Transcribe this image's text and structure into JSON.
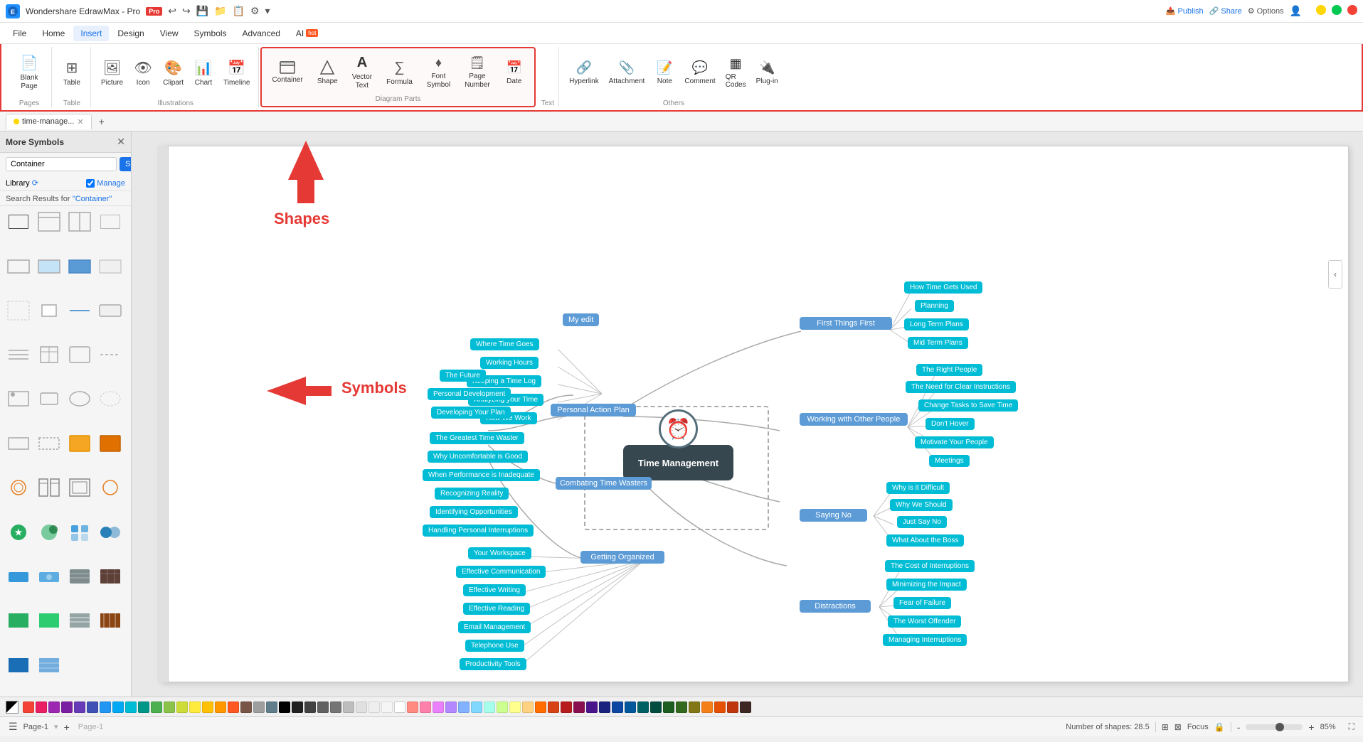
{
  "app": {
    "title": "Wondershare EdrawMax - Pro",
    "logo": "E",
    "filename": "time-manage..."
  },
  "titlebar": {
    "controls": [
      "minimize",
      "maximize",
      "close"
    ]
  },
  "menubar": {
    "items": [
      "File",
      "Home",
      "Insert",
      "Design",
      "View",
      "Symbols",
      "Advanced",
      "AI",
      "Publish",
      "Share",
      "Options"
    ]
  },
  "ribbon": {
    "active_tab": "Insert",
    "groups": [
      {
        "label": "Pages",
        "items": [
          {
            "icon": "📄",
            "label": "Blank\nPage"
          }
        ]
      },
      {
        "label": "Table",
        "items": [
          {
            "icon": "⊞",
            "label": "Table"
          }
        ]
      },
      {
        "label": "Illustrations",
        "items": [
          {
            "icon": "🖼",
            "label": "Picture"
          },
          {
            "icon": "👁",
            "label": "Icon"
          },
          {
            "icon": "🎨",
            "label": "Clipart"
          },
          {
            "icon": "📊",
            "label": "Chart"
          },
          {
            "icon": "📅",
            "label": "Timeline"
          }
        ]
      },
      {
        "label": "Diagram Parts",
        "items": [
          {
            "icon": "▭",
            "label": "Container"
          },
          {
            "icon": "◇",
            "label": "Shape"
          },
          {
            "icon": "A",
            "label": "Vector\nText"
          },
          {
            "icon": "∑",
            "label": "Formula"
          },
          {
            "icon": "♦",
            "label": "Font\nSymbol"
          },
          {
            "icon": "🗒",
            "label": "Page\nNumber"
          },
          {
            "icon": "📅",
            "label": "Date"
          }
        ]
      },
      {
        "label": "Text",
        "items": []
      },
      {
        "label": "Others",
        "items": [
          {
            "icon": "🔗",
            "label": "Hyperlink"
          },
          {
            "icon": "📎",
            "label": "Attachment"
          },
          {
            "icon": "📝",
            "label": "Note"
          },
          {
            "icon": "💬",
            "label": "Comment"
          },
          {
            "icon": "▦",
            "label": "QR\nCodes"
          },
          {
            "icon": "🔌",
            "label": "Plug-in"
          }
        ]
      }
    ]
  },
  "sidebar": {
    "title": "More Symbols",
    "search_placeholder": "Container",
    "search_btn": "Search",
    "library_label": "Library",
    "manage_label": "Manage",
    "search_results_label": "Search Results for",
    "search_results_query": "\"Container\"",
    "shapes_label": "Shapes",
    "symbols_label": "Symbols"
  },
  "tabs": {
    "active": "time-manage...",
    "items": [
      "time-manage..."
    ],
    "add_label": "+"
  },
  "mindmap": {
    "center": "Time Management",
    "clock_visible": true,
    "branches": {
      "my_edit": {
        "label": "My edit",
        "children": [
          "Where Time Goes",
          "Working Hours",
          "Keeping a Time Log",
          "Analyzing your Time",
          "How We Work"
        ]
      },
      "first_things_first": {
        "label": "First Things First",
        "children": [
          "How Time Gets Used",
          "Planning",
          "Long Term Plans",
          "Mid Term Plans"
        ]
      },
      "personal_action_plan": {
        "label": "Personal Action Plan",
        "children": [
          "The Future",
          "Personal Development",
          "Developing Your Plan"
        ]
      },
      "working_with_other_people": {
        "label": "Working with Other People",
        "children": [
          "The Right People",
          "The Need for Clear Instructions",
          "Change Tasks to Save Time",
          "Don't Hover",
          "Motivate Your People",
          "Meetings"
        ]
      },
      "combating_time_wasters": {
        "label": "Combating Time Wasters",
        "children": [
          "The Greatest Time Waster",
          "Why Uncomfortable is Good",
          "When Performance is Inadequate",
          "Recognizing Reality",
          "Identifying Opportunities",
          "Handling Personal Interruptions"
        ]
      },
      "saying_no": {
        "label": "Saying No",
        "children": [
          "Why is it Difficult",
          "Why We Should",
          "Just Say No",
          "What About the Boss"
        ]
      },
      "getting_organized": {
        "label": "Getting Organized",
        "children": [
          "Your Workspace",
          "Effective Communication",
          "Effective Writing",
          "Effective Reading",
          "Email Management",
          "Telephone Use",
          "Productivity Tools"
        ]
      },
      "distractions": {
        "label": "Distractions",
        "children": [
          "The Cost of Interruptions",
          "Minimizing the Impact",
          "Fear of Failure",
          "The Worst Offender",
          "Managing Interruptions"
        ]
      }
    }
  },
  "statusbar": {
    "page_label": "Page-1",
    "add_page": "+",
    "shapes_count": "Number of shapes: 28.5",
    "focus": "Focus",
    "zoom": "85%",
    "zoom_out": "-",
    "zoom_in": "+"
  },
  "colors": {
    "palette": [
      "#f44336",
      "#e91e63",
      "#9c27b0",
      "#673ab7",
      "#3f51b5",
      "#2196f3",
      "#03a9f4",
      "#00bcd4",
      "#009688",
      "#4caf50",
      "#8bc34a",
      "#cddc39",
      "#ffeb3b",
      "#ffc107",
      "#ff9800",
      "#ff5722",
      "#795548",
      "#9e9e9e",
      "#607d8b",
      "#000000",
      "#ffffff",
      "#ff8a80",
      "#ff80ab",
      "#ea80fc",
      "#b388ff",
      "#82b1ff",
      "#80d8ff",
      "#a7ffeb",
      "#ccff90",
      "#ffff8d",
      "#ffd180",
      "#ff6d00"
    ]
  }
}
